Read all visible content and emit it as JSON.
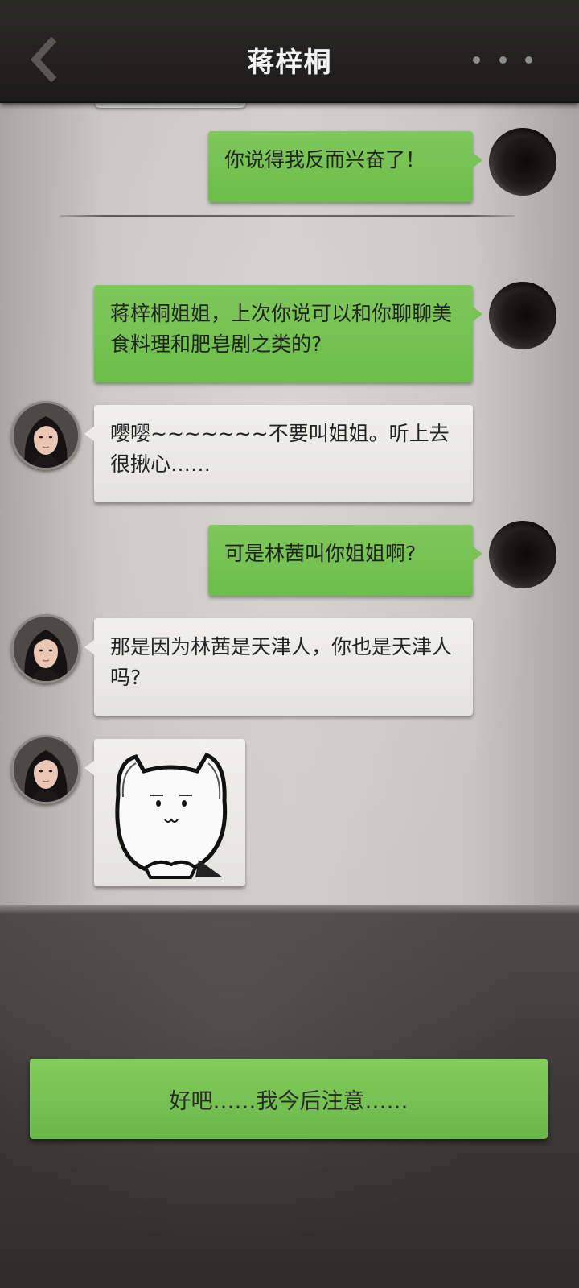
{
  "header": {
    "title": "蒋梓桐",
    "back_icon": "chevron-left-icon",
    "more_icon": "more-dots-icon"
  },
  "messages": [
    {
      "sender": "me",
      "text": "你说得我反而兴奋了！"
    },
    {
      "sender": "me",
      "text": "蒋梓桐姐姐，上次你说可以和你聊聊美食料理和肥皂剧之类的?"
    },
    {
      "sender": "contact",
      "text": "嘤嘤~~~~~~~不要叫姐姐。听上去很揪心……"
    },
    {
      "sender": "me",
      "text": "可是林茜叫你姐姐啊?"
    },
    {
      "sender": "contact",
      "text": "那是因为林茜是天津人，你也是天津人吗?"
    },
    {
      "sender": "contact",
      "type": "sticker",
      "sticker": "cat-arms-crossed-sticker"
    }
  ],
  "reply_option": {
    "text": "好吧……我今后注意……"
  },
  "colors": {
    "green_bubble": "#74c250",
    "white_bubble": "#eae9e6",
    "header_bg": "#232221",
    "paper_bg": "#cac8c3"
  }
}
